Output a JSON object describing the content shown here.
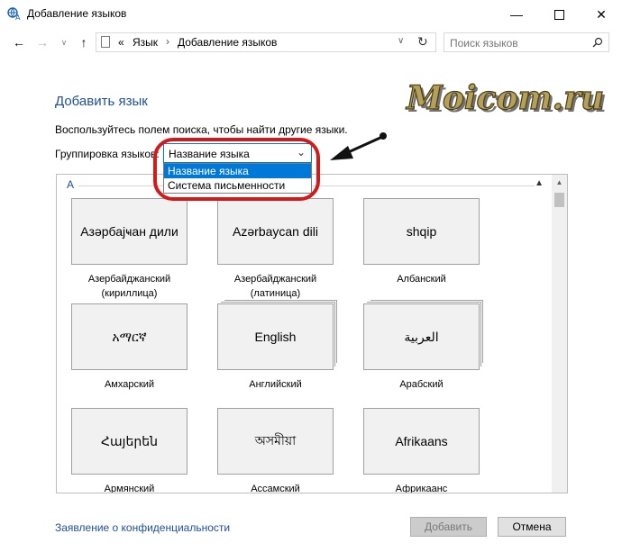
{
  "window": {
    "title": "Добавление языков",
    "minimize_icon": "minimize-icon",
    "maximize_icon": "maximize-icon",
    "close_icon": "close-icon"
  },
  "nav": {
    "back_icon": "back-arrow-icon",
    "forward_icon": "forward-arrow-icon",
    "dropdown_icon": "chevron-down-icon",
    "up_icon": "up-arrow-icon",
    "breadcrumb_prefix": "«",
    "breadcrumb": [
      "Язык",
      "Добавление языков"
    ],
    "breadcrumb_sep": "›",
    "refresh_icon": "refresh-icon",
    "search_placeholder": "Поиск языков",
    "search_icon": "search-icon"
  },
  "main": {
    "heading": "Добавить язык",
    "instruction": "Воспользуйтесь полем поиска, чтобы найти другие языки.",
    "group_label": "Группировка языков:",
    "group_selected": "Название языка",
    "group_options": [
      "Название языка",
      "Система письменности"
    ],
    "section_letter": "A"
  },
  "languages": [
    {
      "native": "Азәрбајҹан дили",
      "name": "Азербайджанский (кириллица)",
      "stacked": false
    },
    {
      "native": "Azərbaycan dili",
      "name": "Азербайджанский (латиница)",
      "stacked": false
    },
    {
      "native": "shqip",
      "name": "Албанский",
      "stacked": false
    },
    {
      "native": "አማርኛ",
      "name": "Амхарский",
      "stacked": false
    },
    {
      "native": "English",
      "name": "Английский",
      "stacked": true
    },
    {
      "native": "العربية",
      "name": "Арабский",
      "stacked": true
    },
    {
      "native": "Հայերեն",
      "name": "Армянский",
      "stacked": false
    },
    {
      "native": "অসমীয়া",
      "name": "Ассамский",
      "stacked": false
    },
    {
      "native": "Afrikaans",
      "name": "Африкаанс",
      "stacked": false
    }
  ],
  "footer": {
    "privacy": "Заявление о конфиденциальности",
    "add": "Добавить",
    "cancel": "Отмена"
  },
  "watermark": {
    "text": "Moicom.ru"
  },
  "colors": {
    "accent": "#0078d7",
    "link": "#1f4e9c",
    "annotation": "#d21a1a"
  }
}
